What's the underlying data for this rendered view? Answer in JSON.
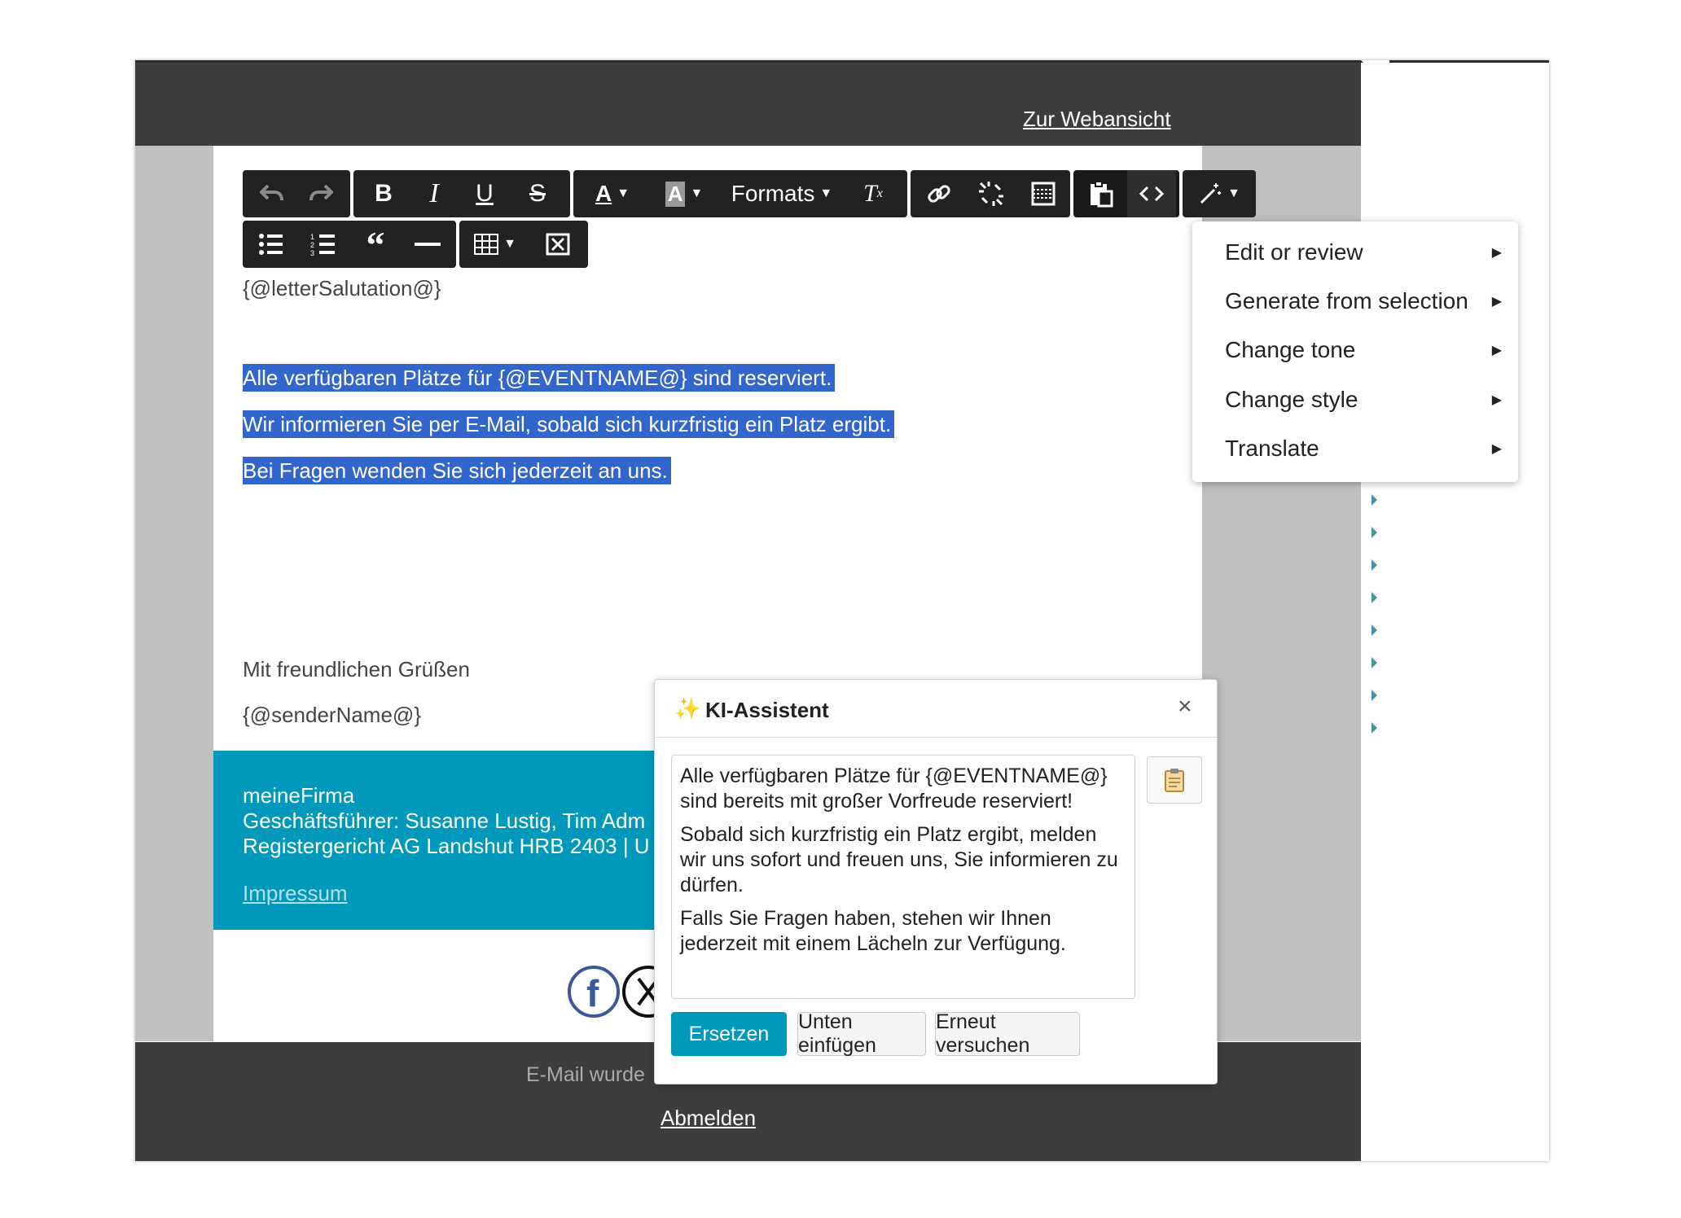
{
  "header": {
    "web_link": "Zur Webansicht"
  },
  "toolbar": {
    "formats_label": "Formats"
  },
  "email": {
    "salutation": "{@letterSalutation@}",
    "selected_lines": [
      "Alle verfügbaren Plätze für {@EVENTNAME@} sind reserviert.",
      "Wir informieren Sie per E-Mail, sobald sich kurzfristig ein Platz ergibt.",
      "Bei Fragen wenden Sie sich jederzeit an uns."
    ],
    "closing": "Mit freundlichen Grüßen",
    "sender": "{@senderName@}"
  },
  "company_footer": {
    "company": "meineFirma",
    "managing": "Geschäftsführer: Susanne Lustig, Tim Adm",
    "register": "Registergericht AG Landshut HRB 2403 | U",
    "impressum": "Impressum"
  },
  "bottom_footer": {
    "sent_text": "E-Mail wurde",
    "unsubscribe": "Abmelden"
  },
  "ai_menu": {
    "items": [
      {
        "label": "Edit or review"
      },
      {
        "label": "Generate from selection"
      },
      {
        "label": "Change tone"
      },
      {
        "label": "Change style"
      },
      {
        "label": "Translate"
      }
    ]
  },
  "dialog": {
    "title": "KI-Assistent",
    "close": "×",
    "paragraphs": [
      "Alle verfügbaren Plätze für {@EVENTNAME@} sind bereits mit großer Vorfreude reserviert!",
      "Sobald sich kurzfristig ein Platz ergibt, melden wir uns sofort und freuen uns, Sie informieren zu dürfen.",
      "Falls Sie Fragen haben, stehen wir Ihnen jederzeit mit einem Lächeln zur Verfügung."
    ],
    "buttons": {
      "replace": "Ersetzen",
      "insert_below": "Unten einfügen",
      "retry": "Erneut versuchen"
    }
  },
  "colors": {
    "selection": "#3366cc",
    "teal": "#0099bb",
    "dark": "#3d3d3d",
    "toolbar": "#222222"
  }
}
